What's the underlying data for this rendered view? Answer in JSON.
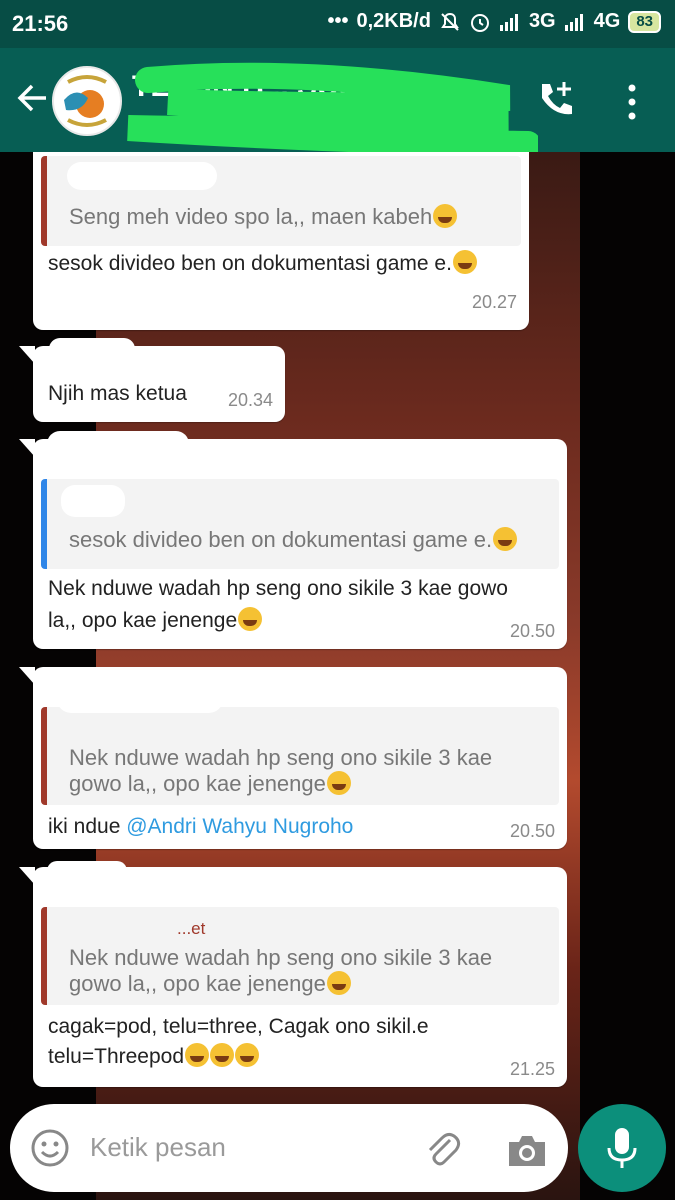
{
  "status_bar": {
    "time": "21:56",
    "network_speed": "0,2KB/d",
    "net1": "3G",
    "net2": "4G",
    "battery": "83"
  },
  "header": {
    "chat_title": "TELON B... SUP",
    "colors": {
      "appbar": "#075e54",
      "statusbar": "#074d45",
      "scribble": "#27e05a"
    }
  },
  "messages": [
    {
      "quote_text": "Seng meh video spo la,, maen kabeh",
      "text": "sesok divideo ben on dokumentasi game e.",
      "time": "20.27"
    },
    {
      "text": "Njih mas ketua",
      "time": "20.34"
    },
    {
      "quote_text": "sesok divideo ben on dokumentasi game e.",
      "text_line1": "Nek nduwe wadah hp seng ono sikile 3 kae gowo",
      "text_line2": "la,, opo kae jenenge",
      "time": "20.50"
    },
    {
      "quote_line1": "Nek nduwe wadah hp seng ono sikile 3 kae",
      "quote_line2": "gowo la,, opo kae jenenge",
      "text": "iki ndue ",
      "mention": "@Andri Wahyu Nugroho",
      "time": "20.50"
    },
    {
      "quote_name": "...et",
      "quote_line1": "Nek nduwe wadah hp seng ono sikile 3 kae",
      "quote_line2": "gowo la,, opo kae jenenge",
      "text_line1": "cagak=pod, telu=three, Cagak ono sikil.e",
      "text_line2": "telu=Threepod",
      "time": "21.25"
    }
  ],
  "input": {
    "placeholder": "Ketik pesan"
  },
  "icons": [
    "back-arrow-icon",
    "add-call-icon",
    "more-vert-icon",
    "emoji-icon",
    "attach-icon",
    "camera-icon",
    "mic-icon",
    "signal-icon",
    "alarm-icon",
    "mute-icon"
  ]
}
